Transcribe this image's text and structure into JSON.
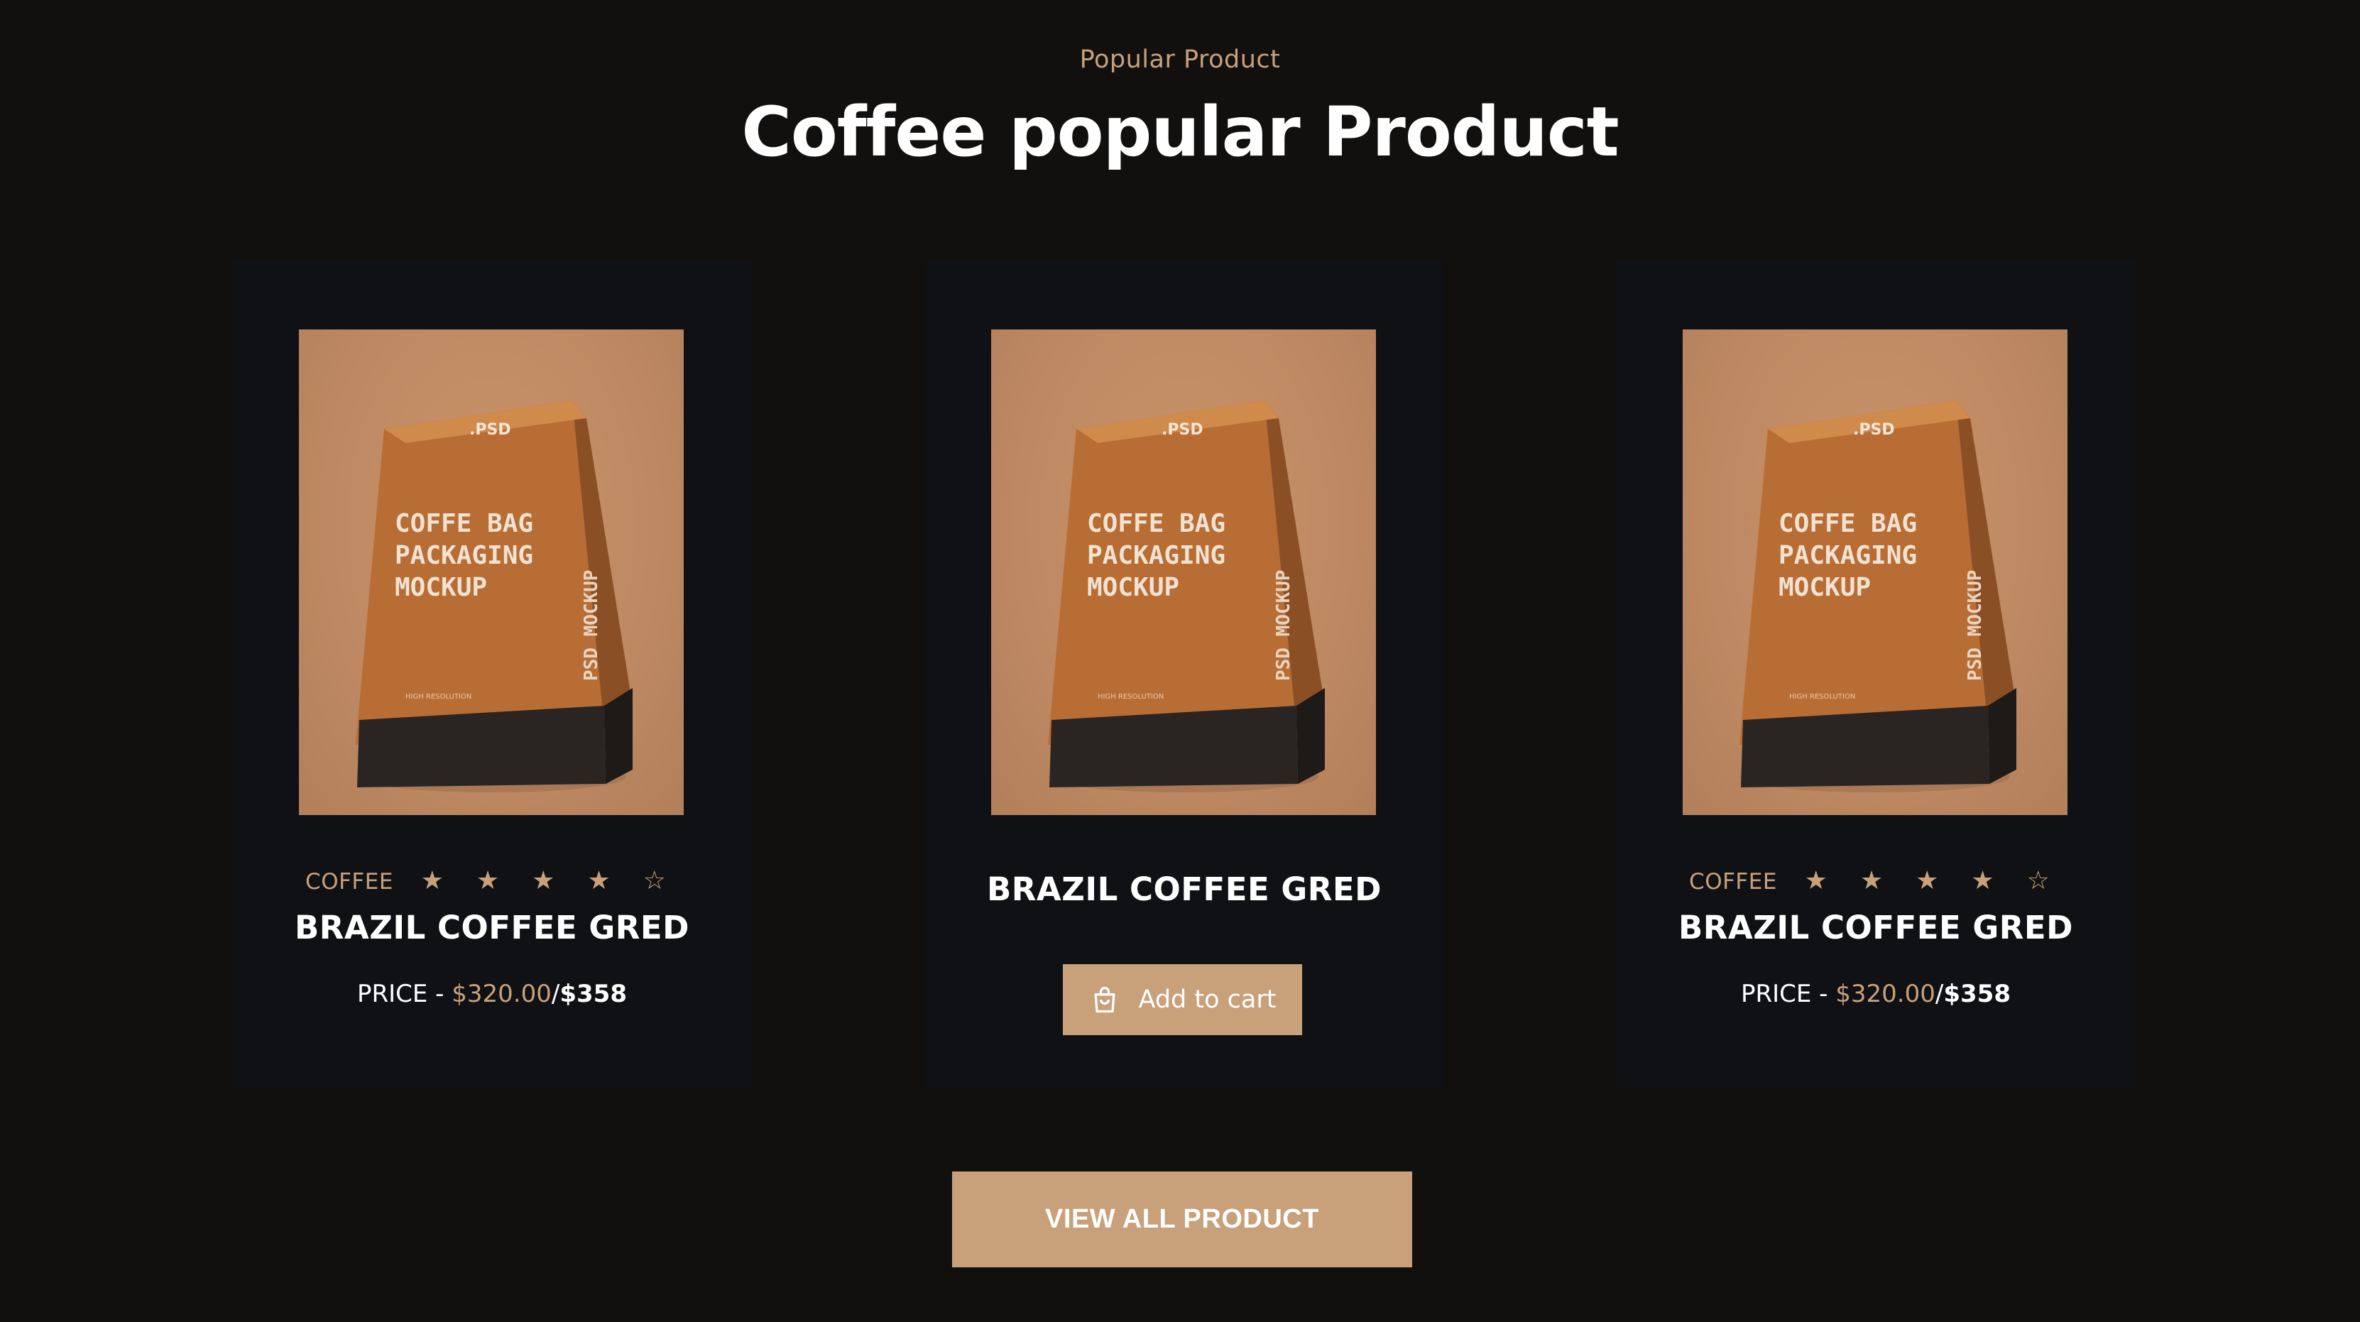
{
  "section": {
    "eyebrow": "Popular Product",
    "title": "Coffee popular Product"
  },
  "products": [
    {
      "image_text": {
        "top": ".PSD",
        "line1": "COFFE BAG",
        "line2": "PACKAGING",
        "line3": "MOCKUP",
        "side": "PSD MOCKUP",
        "footer": "HIGH RESOLUTION"
      },
      "category": "COFFEE",
      "rating": "★ ★ ★ ★ ☆",
      "name": "BRAZIL COFFEE GRED",
      "price_label": "PRICE - ",
      "price_sale": "$320.00",
      "price_separator": "/",
      "price_regular": "$358"
    },
    {
      "image_text": {
        "top": ".PSD",
        "line1": "COFFE BAG",
        "line2": "PACKAGING",
        "line3": "MOCKUP",
        "side": "PSD MOCKUP",
        "footer": "HIGH RESOLUTION"
      },
      "name": "BRAZIL COFFEE GRED",
      "add_to_cart_label": "Add to cart"
    },
    {
      "image_text": {
        "top": ".PSD",
        "line1": "COFFE BAG",
        "line2": "PACKAGING",
        "line3": "MOCKUP",
        "side": "PSD MOCKUP",
        "footer": "HIGH RESOLUTION"
      },
      "category": "COFFEE",
      "rating": "★ ★ ★ ★ ☆",
      "name": "BRAZIL COFFEE GRED",
      "price_label": "PRICE - ",
      "price_sale": "$320.00",
      "price_separator": "/",
      "price_regular": "$358"
    }
  ],
  "view_all_label": "VIEW ALL PRODUCT",
  "colors": {
    "background": "#12100e",
    "card": "#0f1114",
    "accent": "#c8a07a",
    "text": "#ffffff"
  }
}
